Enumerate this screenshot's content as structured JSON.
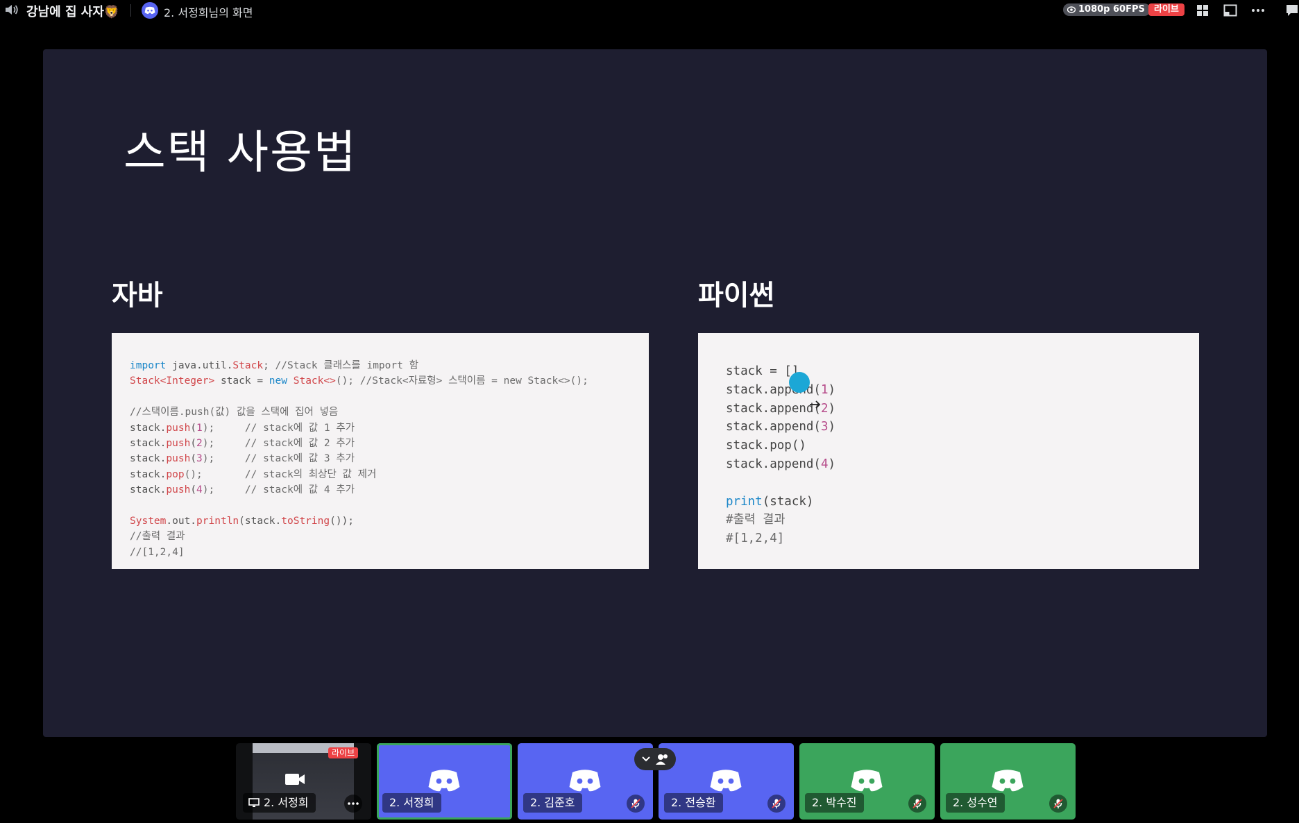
{
  "topbar": {
    "channel_name": "강남에 집 사자🦁",
    "stream_title": "2. 서정희님의 화면",
    "quality": "1080p 60FPS",
    "live_label": "라이브",
    "icons": [
      "speaker-icon",
      "discord-logo-icon",
      "eye-icon",
      "grid-layout-icon",
      "popout-window-icon",
      "more-options-icon",
      "chat-icon"
    ]
  },
  "slide": {
    "title": "스택 사용법",
    "java": {
      "heading": "자바",
      "lines": [
        [
          {
            "t": "import",
            "c": "kw"
          },
          {
            "t": " java.util.",
            "c": ""
          },
          {
            "t": "Stack",
            "c": "ty"
          },
          {
            "t": "; //Stack 클래스를 import 함",
            "c": "cm"
          }
        ],
        [
          {
            "t": "Stack<Integer>",
            "c": "ty"
          },
          {
            "t": " stack = ",
            "c": ""
          },
          {
            "t": "new",
            "c": "kw"
          },
          {
            "t": " ",
            "c": ""
          },
          {
            "t": "Stack<>",
            "c": "ty"
          },
          {
            "t": "(); //Stack<자료형> 스택이름 = new Stack<>();",
            "c": "cm"
          }
        ],
        [],
        [
          {
            "t": "//스택이름.push(값) 값을 스택에 집어 넣음",
            "c": "cm"
          }
        ],
        [
          {
            "t": "stack.",
            "c": ""
          },
          {
            "t": "push",
            "c": "fn"
          },
          {
            "t": "(",
            "c": ""
          },
          {
            "t": "1",
            "c": "num"
          },
          {
            "t": ");     // stack에 값 1 추가",
            "c": "cm"
          }
        ],
        [
          {
            "t": "stack.",
            "c": ""
          },
          {
            "t": "push",
            "c": "fn"
          },
          {
            "t": "(",
            "c": ""
          },
          {
            "t": "2",
            "c": "num"
          },
          {
            "t": ");     // stack에 값 2 추가",
            "c": "cm"
          }
        ],
        [
          {
            "t": "stack.",
            "c": ""
          },
          {
            "t": "push",
            "c": "fn"
          },
          {
            "t": "(",
            "c": ""
          },
          {
            "t": "3",
            "c": "num"
          },
          {
            "t": ");     // stack에 값 3 추가",
            "c": "cm"
          }
        ],
        [
          {
            "t": "stack.",
            "c": ""
          },
          {
            "t": "pop",
            "c": "fn"
          },
          {
            "t": "();       // stack의 최상단 값 제거",
            "c": "cm"
          }
        ],
        [
          {
            "t": "stack.",
            "c": ""
          },
          {
            "t": "push",
            "c": "fn"
          },
          {
            "t": "(",
            "c": ""
          },
          {
            "t": "4",
            "c": "num"
          },
          {
            "t": ");     // stack에 값 4 추가",
            "c": "cm"
          }
        ],
        [],
        [
          {
            "t": "System",
            "c": "ty"
          },
          {
            "t": ".out.",
            "c": ""
          },
          {
            "t": "println",
            "c": "fn"
          },
          {
            "t": "(stack.",
            "c": ""
          },
          {
            "t": "toString",
            "c": "fn"
          },
          {
            "t": "());",
            "c": ""
          }
        ],
        [
          {
            "t": "//출력 결과",
            "c": "cm"
          }
        ],
        [
          {
            "t": "//[1,2,4]",
            "c": "cm"
          }
        ]
      ]
    },
    "python": {
      "heading": "파이썬",
      "lines": [
        [
          {
            "t": "stack = []",
            "c": ""
          }
        ],
        [
          {
            "t": "stack.append(",
            "c": ""
          },
          {
            "t": "1",
            "c": "num"
          },
          {
            "t": ")",
            "c": ""
          }
        ],
        [
          {
            "t": "stack.append(",
            "c": ""
          },
          {
            "t": "2",
            "c": "num"
          },
          {
            "t": ")",
            "c": ""
          }
        ],
        [
          {
            "t": "stack.append(",
            "c": ""
          },
          {
            "t": "3",
            "c": "num"
          },
          {
            "t": ")",
            "c": ""
          }
        ],
        [
          {
            "t": "stack.pop()",
            "c": ""
          }
        ],
        [
          {
            "t": "stack.append(",
            "c": ""
          },
          {
            "t": "4",
            "c": "num"
          },
          {
            "t": ")",
            "c": ""
          }
        ],
        [],
        [
          {
            "t": "print",
            "c": "kw"
          },
          {
            "t": "(stack)",
            "c": ""
          }
        ],
        [
          {
            "t": "#출력 결과",
            "c": "cm"
          }
        ],
        [
          {
            "t": "#[1,2,4]",
            "c": "cm"
          }
        ]
      ]
    }
  },
  "participants": {
    "screen_share": {
      "name": "2. 서정희",
      "live_label": "라이브"
    },
    "tiles": [
      {
        "name": "2. 서정희",
        "color": "#5865f2",
        "muted": false,
        "selected": true
      },
      {
        "name": "2. 김준호",
        "color": "#5865f2",
        "muted": true,
        "selected": false
      },
      {
        "name": "2. 전승환",
        "color": "#5865f2",
        "muted": true,
        "selected": false
      },
      {
        "name": "2. 박수진",
        "color": "#3ba55c",
        "muted": true,
        "selected": false
      },
      {
        "name": "2. 성수연",
        "color": "#3ba55c",
        "muted": true,
        "selected": false
      }
    ]
  },
  "colors": {
    "blurple": "#5865f2",
    "green": "#3ba55c",
    "live_red": "#ed4245",
    "slide_bg": "#1e1e30"
  }
}
